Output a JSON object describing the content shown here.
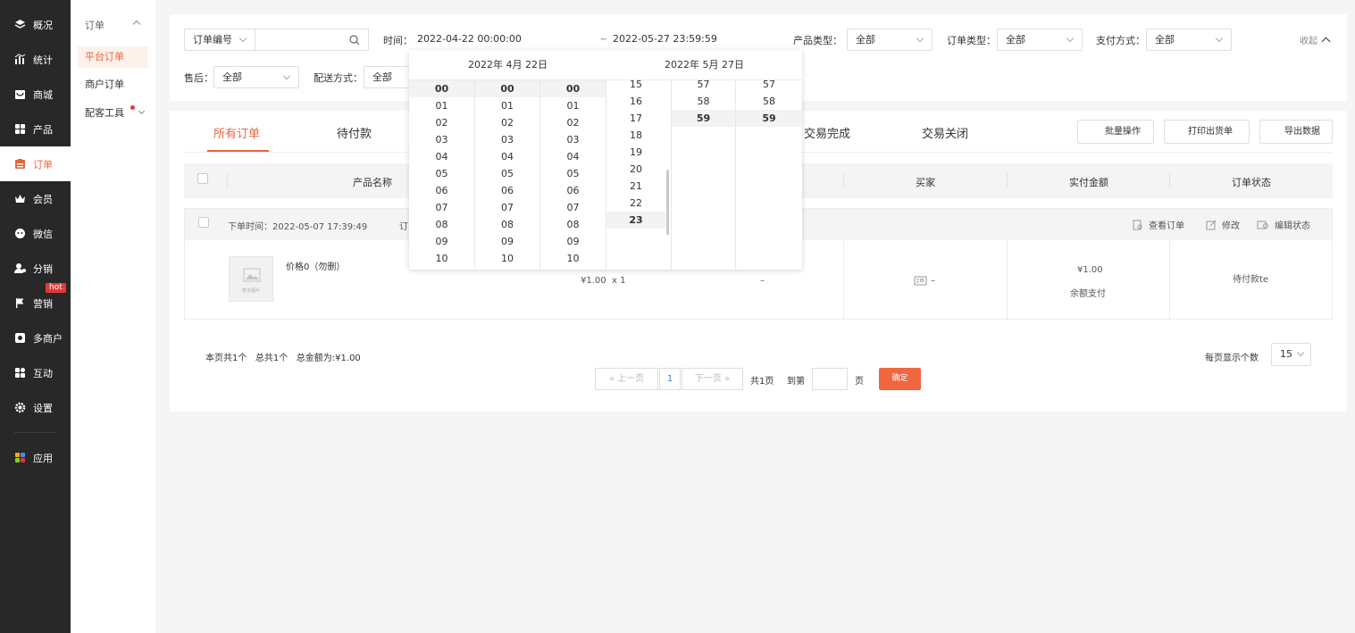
{
  "sidebar": {
    "items": [
      {
        "label": "概况",
        "icon": "layers-icon"
      },
      {
        "label": "统计",
        "icon": "chart-icon"
      },
      {
        "label": "商城",
        "icon": "shop-icon"
      },
      {
        "label": "产品",
        "icon": "grid-icon"
      },
      {
        "label": "订单",
        "icon": "order-icon"
      },
      {
        "label": "会员",
        "icon": "crown-icon"
      },
      {
        "label": "微信",
        "icon": "wechat-icon"
      },
      {
        "label": "分销",
        "icon": "distribution-icon"
      },
      {
        "label": "营销",
        "icon": "flag-icon"
      },
      {
        "label": "多商户",
        "icon": "merchant-icon"
      },
      {
        "label": "互动",
        "icon": "interact-icon"
      },
      {
        "label": "设置",
        "icon": "gear-icon"
      },
      {
        "label": "应用",
        "icon": "apps-icon"
      }
    ],
    "hot_badge": "hot"
  },
  "subnav": {
    "group": "订单",
    "items": [
      "平台订单",
      "商户订单",
      "配客工具"
    ]
  },
  "filters": {
    "order_no_select": "订单编号",
    "time_label": "时间：",
    "time_start": "2022-04-22 00:00:00",
    "time_sep": "~",
    "time_end": "2022-05-27 23:59:59",
    "product_type_label": "产品类型：",
    "product_type_value": "全部",
    "order_type_label": "订单类型：",
    "order_type_value": "全部",
    "pay_label": "支付方式：",
    "pay_value": "全部",
    "collapse": "收起",
    "after_sale_label": "售后：",
    "after_sale_value": "全部",
    "delivery_label": "配送方式：",
    "delivery_value": "全部"
  },
  "tabs": [
    "所有订单",
    "待付款",
    "交易完成",
    "交易关闭"
  ],
  "actions": {
    "batch": "批量操作",
    "print": "打印出货单",
    "export": "导出数据"
  },
  "table": {
    "headers": {
      "product": "产品名称",
      "buyer": "买家",
      "paid": "实付金额",
      "status": "订单状态"
    },
    "order": {
      "time_text": "下单时间：2022-05-07 17:39:49",
      "no_prefix": "订",
      "view": "查看订单",
      "edit": "修改",
      "edit_status": "编辑状态",
      "product_name": "价格0（勿删）",
      "thumb_text": "暂无图片",
      "price_qty": "¥1.00  x 1",
      "dash": "–",
      "buyer_text": "–",
      "paid_amount": "¥1.00",
      "pay_method": "余额支付",
      "status": "待付款te"
    }
  },
  "summary": "本页共1个   总共1个   总金额为:¥1.00",
  "pagination": {
    "prev": "上一页",
    "current": "1",
    "next": "下一页",
    "total_pages": "共1页",
    "goto": "到第",
    "page_unit": "页",
    "confirm": "确定",
    "per_page_label": "每页显示个数",
    "per_page_value": "15"
  },
  "picker": {
    "left_header": "2022年 4月 22日",
    "right_header": "2022年 5月 27日",
    "left_cols": [
      [
        "00",
        "01",
        "02",
        "03",
        "04",
        "05",
        "06",
        "07",
        "08",
        "09",
        "10"
      ],
      [
        "00",
        "01",
        "02",
        "03",
        "04",
        "05",
        "06",
        "07",
        "08",
        "09",
        "10"
      ],
      [
        "00",
        "01",
        "02",
        "03",
        "04",
        "05",
        "06",
        "07",
        "08",
        "09",
        "10"
      ]
    ],
    "right_hours": [
      "15",
      "16",
      "17",
      "18",
      "19",
      "20",
      "21",
      "22",
      "23"
    ],
    "right_minutes": [
      "57",
      "58",
      "59"
    ],
    "right_seconds": [
      "57",
      "58",
      "59"
    ]
  },
  "colors": {
    "accent": "#e8663d",
    "sidebar": "#282828",
    "hot": "#e4393c"
  }
}
